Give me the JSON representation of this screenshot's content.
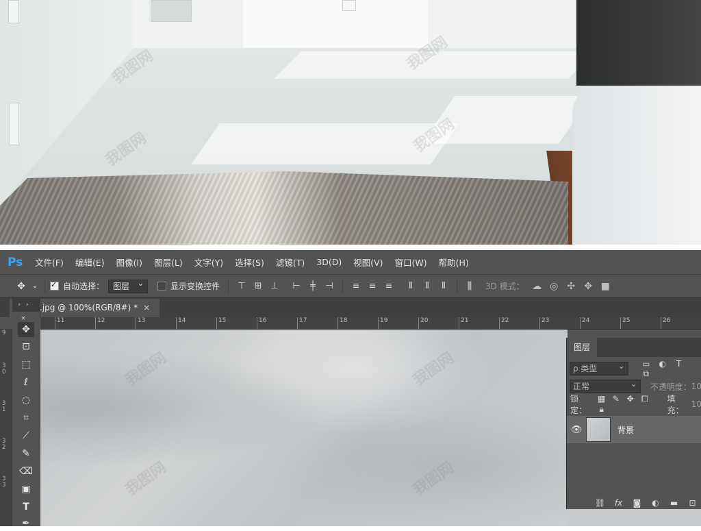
{
  "app": {
    "logo": "Ps"
  },
  "menu": [
    "文件(F)",
    "编辑(E)",
    "图像(I)",
    "图层(L)",
    "文字(Y)",
    "选择(S)",
    "滤镜(T)",
    "3D(D)",
    "视图(V)",
    "窗口(W)",
    "帮助(H)"
  ],
  "options": {
    "auto_select_label": "自动选择：",
    "auto_select_checked": true,
    "auto_select_target": "图层",
    "show_transform_label": "显示变换控件",
    "show_transform_checked": false,
    "mode_label": "3D 模式："
  },
  "document": {
    "tab_title": ".jpg @ 100%(RGB/8#) *",
    "close": "×"
  },
  "toolbar_header": "›› ×",
  "ruler_h": [
    "11",
    "12",
    "13",
    "14",
    "15",
    "16",
    "17",
    "18",
    "19",
    "20",
    "21",
    "22",
    "23",
    "24",
    "25",
    "26"
  ],
  "ruler_v": [
    "9",
    "30",
    "31",
    "32",
    "33"
  ],
  "layers_panel": {
    "tab_label": "图层",
    "kind_placeholder": "ρ 类型",
    "blend_mode": "正常",
    "opacity_label": "不透明度：",
    "opacity_value": "10",
    "lock_label": "锁定：",
    "fill_label": "填充：",
    "fill_value": "10",
    "layers": [
      {
        "name": "背景",
        "visible": true
      }
    ]
  },
  "watermark": "我图网"
}
